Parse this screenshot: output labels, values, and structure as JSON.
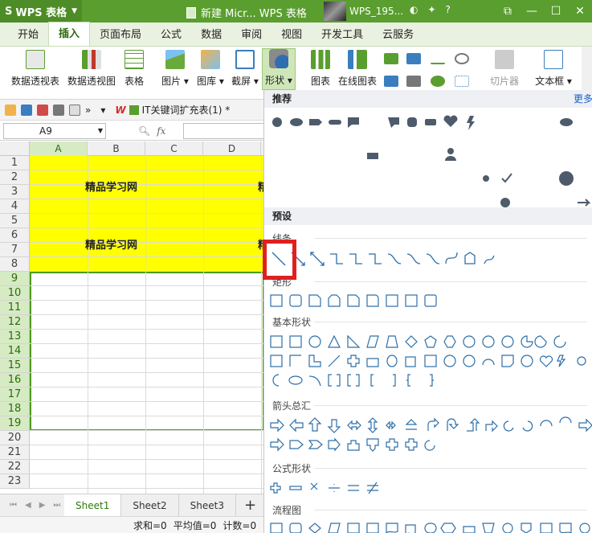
{
  "titlebar": {
    "app_name": "WPS 表格",
    "doc_title": "新建 Micr... WPS 表格",
    "user_name": "WPS_195..."
  },
  "menu": {
    "tabs": [
      "开始",
      "插入",
      "页面布局",
      "公式",
      "数据",
      "审阅",
      "视图",
      "开发工具",
      "云服务"
    ],
    "active_tab": "插入"
  },
  "ribbon": {
    "buttons": [
      "数据透视表",
      "数据透视图",
      "表格",
      "图片",
      "图库",
      "截屏",
      "形状",
      "图表",
      "在线图表",
      "切片器",
      "文本框"
    ]
  },
  "quick_access": {
    "doc_tab": "IT关键词扩充表(1) *"
  },
  "formula_bar": {
    "name_box": "A9",
    "fx_label": "fx",
    "formula": ""
  },
  "grid": {
    "columns": [
      "A",
      "B",
      "C",
      "D"
    ],
    "rows": [
      "1",
      "2",
      "3",
      "4",
      "5",
      "6",
      "7",
      "8",
      "9",
      "10",
      "11",
      "12",
      "13",
      "14",
      "15",
      "16",
      "17",
      "18",
      "19",
      "20",
      "21",
      "22",
      "23"
    ],
    "cell_b3": "精品学习网",
    "cell_b7": "精品学习网",
    "cell_e3_partial": "精",
    "cell_e7_partial": "精"
  },
  "sheets": {
    "tabs": [
      "Sheet1",
      "Sheet2",
      "Sheet3"
    ],
    "active": "Sheet1",
    "add": "+"
  },
  "status": {
    "sum": "求和=0",
    "avg": "平均值=0",
    "count": "计数=0"
  },
  "shapes_panel": {
    "recommended": "推荐",
    "more": "更多",
    "preset": "预设",
    "lines": "线条",
    "rectangles": "矩形",
    "basic": "基本形状",
    "arrows": "箭头总汇",
    "equation": "公式形状",
    "flowchart": "流程图"
  },
  "colors": {
    "title_green": "#5a9e2f",
    "accent_green": "#4f9a22",
    "cell_yellow": "#ffff00",
    "highlight_red": "#e02020",
    "shape_blue": "#2e6fa8"
  }
}
